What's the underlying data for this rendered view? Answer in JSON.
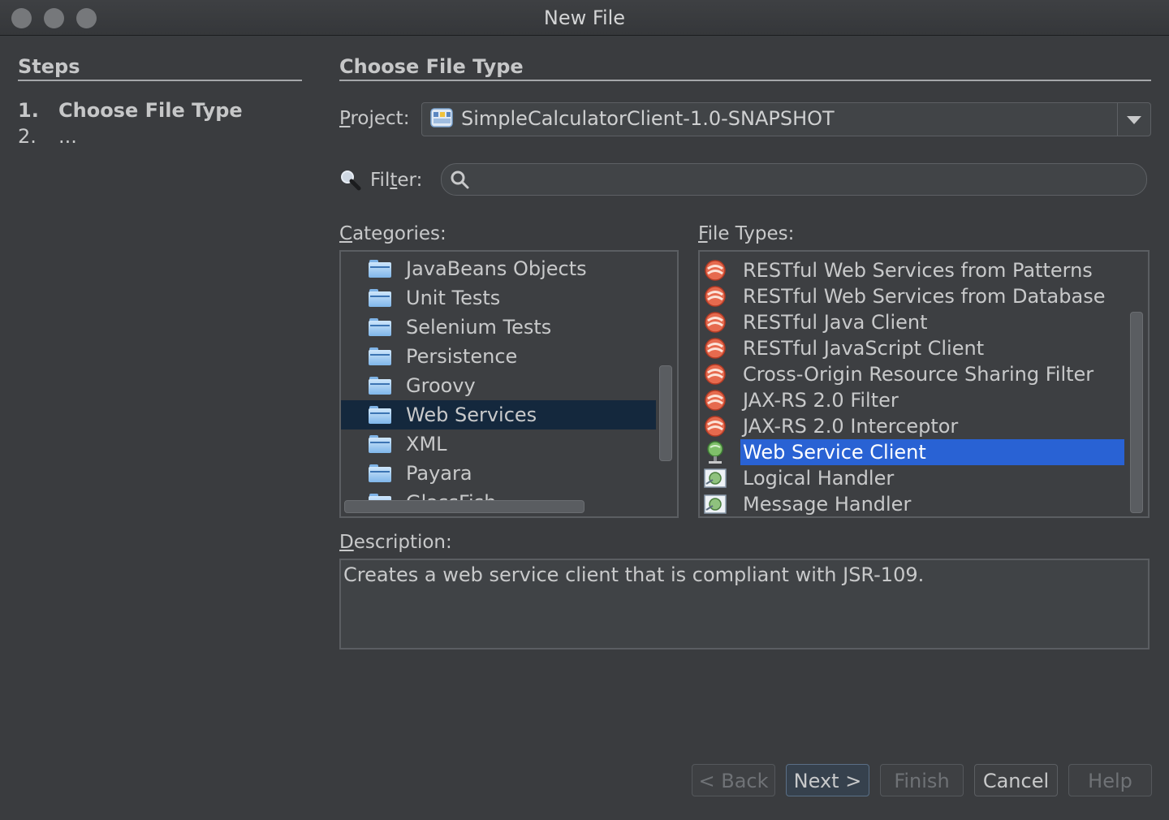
{
  "window": {
    "title": "New File"
  },
  "steps": {
    "heading": "Steps",
    "items": [
      {
        "num": "1.",
        "label": "Choose File Type"
      },
      {
        "num": "2.",
        "label": "..."
      }
    ]
  },
  "main": {
    "heading": "Choose File Type",
    "project": {
      "label_prefix": "P",
      "label_rest": "roject:",
      "value": "SimpleCalculatorClient-1.0-SNAPSHOT"
    },
    "filter": {
      "label_pre": "Fil",
      "label_u": "t",
      "label_post": "er:",
      "value": ""
    },
    "categories": {
      "label_u": "C",
      "label_rest": "ategories:",
      "items": [
        "JavaBeans Objects",
        "Unit Tests",
        "Selenium Tests",
        "Persistence",
        "Groovy",
        "Web Services",
        "XML",
        "Payara",
        "GlassFish"
      ],
      "selected": "Web Services"
    },
    "file_types": {
      "label_u": "F",
      "label_rest": "ile Types:",
      "items": [
        {
          "label": "RESTful Web Services from Patterns",
          "icon": "restful-icon"
        },
        {
          "label": "RESTful Web Services from Database",
          "icon": "restful-icon"
        },
        {
          "label": "RESTful Java Client",
          "icon": "restful-icon"
        },
        {
          "label": "RESTful JavaScript Client",
          "icon": "restful-icon"
        },
        {
          "label": "Cross-Origin Resource Sharing Filter",
          "icon": "restful-icon"
        },
        {
          "label": "JAX-RS 2.0 Filter",
          "icon": "restful-icon"
        },
        {
          "label": "JAX-RS 2.0 Interceptor",
          "icon": "restful-icon"
        },
        {
          "label": "Web Service Client",
          "icon": "web-service-client-icon"
        },
        {
          "label": "Logical Handler",
          "icon": "handler-icon"
        },
        {
          "label": "Message Handler",
          "icon": "handler-icon"
        }
      ],
      "selected": "Web Service Client"
    },
    "description": {
      "label_u": "D",
      "label_rest": "escription:",
      "text": "Creates a web service client that is compliant with JSR-109."
    }
  },
  "buttons": {
    "back": "< Back",
    "next": "Next >",
    "finish": "Finish",
    "cancel": "Cancel",
    "help": "Help"
  },
  "colors": {
    "selection": "#2962d4",
    "selection_inactive": "#14283d",
    "background": "#3a3c3f"
  }
}
